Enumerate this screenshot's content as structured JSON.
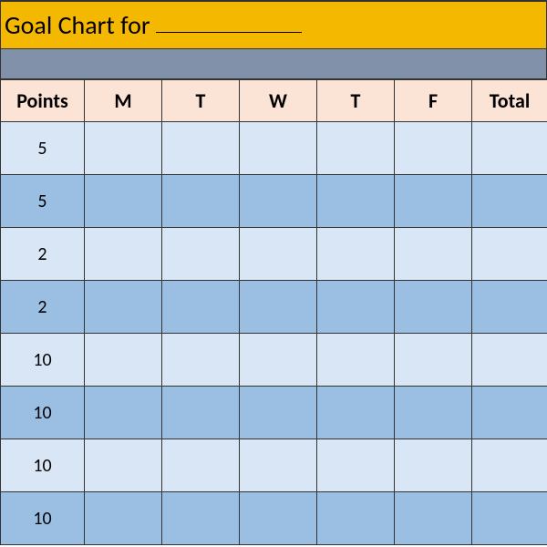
{
  "title": {
    "prefix": "Goal Chart for"
  },
  "headers": [
    "Points",
    "M",
    "T",
    "W",
    "T",
    "F",
    "Total"
  ],
  "rows": [
    {
      "shade": "light",
      "points": "5",
      "cells": [
        "",
        "",
        "",
        "",
        "",
        ""
      ]
    },
    {
      "shade": "dark",
      "points": "5",
      "cells": [
        "",
        "",
        "",
        "",
        "",
        ""
      ]
    },
    {
      "shade": "light",
      "points": "2",
      "cells": [
        "",
        "",
        "",
        "",
        "",
        ""
      ]
    },
    {
      "shade": "dark",
      "points": "2",
      "cells": [
        "",
        "",
        "",
        "",
        "",
        ""
      ]
    },
    {
      "shade": "light",
      "points": "10",
      "cells": [
        "",
        "",
        "",
        "",
        "",
        ""
      ]
    },
    {
      "shade": "dark",
      "points": "10",
      "cells": [
        "",
        "",
        "",
        "",
        "",
        ""
      ]
    },
    {
      "shade": "light",
      "points": "10",
      "cells": [
        "",
        "",
        "",
        "",
        "",
        ""
      ]
    },
    {
      "shade": "dark",
      "points": "10",
      "cells": [
        "",
        "",
        "",
        "",
        "",
        ""
      ]
    }
  ]
}
